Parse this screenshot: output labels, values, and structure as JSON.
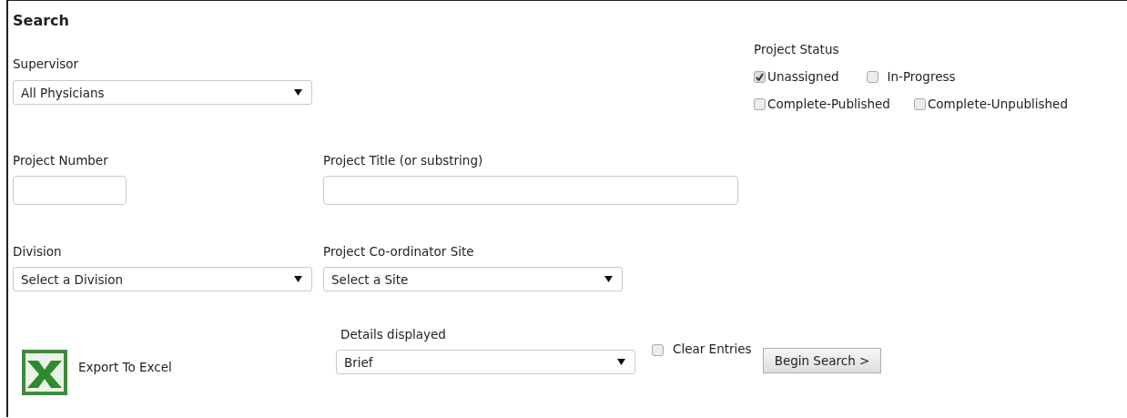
{
  "title": "Search",
  "supervisor": {
    "label": "Supervisor",
    "value": "All Physicians"
  },
  "project_status": {
    "label": "Project Status",
    "options": [
      {
        "label": "Unassigned",
        "checked": true
      },
      {
        "label": "In-Progress",
        "checked": false
      },
      {
        "label": "Complete-Published",
        "checked": false
      },
      {
        "label": "Complete-Unpublished",
        "checked": false
      }
    ]
  },
  "project_number": {
    "label": "Project Number"
  },
  "project_title": {
    "label": "Project Title (or substring)"
  },
  "division": {
    "label": "Division",
    "value": "Select a Division"
  },
  "site": {
    "label": "Project Co-ordinator Site",
    "value": "Select a Site"
  },
  "export": {
    "label": "Export To Excel"
  },
  "details": {
    "label": "Details displayed",
    "value": "Brief"
  },
  "clear_entries": {
    "label": "Clear Entries",
    "checked": false
  },
  "search_button": {
    "label": "Begin Search >"
  }
}
